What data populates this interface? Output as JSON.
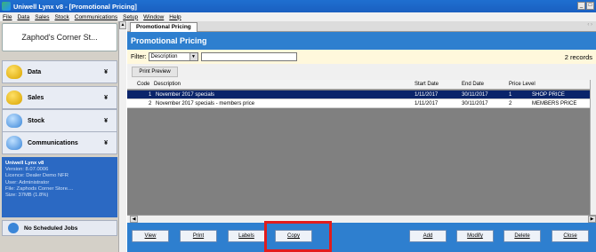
{
  "window": {
    "title": "Uniwell Lynx v8 - [Promotional Pricing]",
    "controls": [
      "_",
      "□"
    ]
  },
  "menu": [
    "File",
    "Data",
    "Sales",
    "Stock",
    "Communications",
    "Setup",
    "Window",
    "Help"
  ],
  "sidebar": {
    "store_name": "Zaphod's Corner St...",
    "items": [
      {
        "label": "Data",
        "icon": "database-icon"
      },
      {
        "label": "Sales",
        "icon": "sales-icon"
      },
      {
        "label": "Stock",
        "icon": "stock-icon"
      },
      {
        "label": "Communications",
        "icon": "communications-icon"
      }
    ],
    "info": {
      "product": "Uniwell Lynx v8",
      "version": "Version: 8.07.0006",
      "licence": "Licence: Dealer Demo NFR",
      "user": "User: Administrator",
      "file": "File: Zaphods Corner Store....",
      "size": "Size: 37MB (1.8%)"
    },
    "jobs": "No Scheduled Jobs"
  },
  "main": {
    "tab": "Promotional Pricing",
    "banner": "Promotional Pricing",
    "filter": {
      "label": "Filter:",
      "selected": "Description",
      "value": ""
    },
    "records": "2 records",
    "print_preview": "Print Preview",
    "columns": [
      "Code",
      "Description",
      "Start Date",
      "End Date",
      "Price Level"
    ],
    "rows": [
      {
        "code": "1",
        "description": "November 2017 specials",
        "start": "1/11/2017",
        "end": "30/11/2017",
        "level_num": "1",
        "level_name": "SHOP PRICE",
        "selected": true
      },
      {
        "code": "2",
        "description": "November 2017 specials - members price",
        "start": "1/11/2017",
        "end": "30/11/2017",
        "level_num": "2",
        "level_name": "MEMBERS PRICE",
        "selected": false
      }
    ],
    "buttons": [
      "View",
      "Print",
      "Labels",
      "Copy",
      "Add",
      "Modify",
      "Delete",
      "Close"
    ]
  },
  "colors": {
    "accent": "#2e7fcf",
    "selection": "#0a246a",
    "highlight": "#e21c1c"
  }
}
